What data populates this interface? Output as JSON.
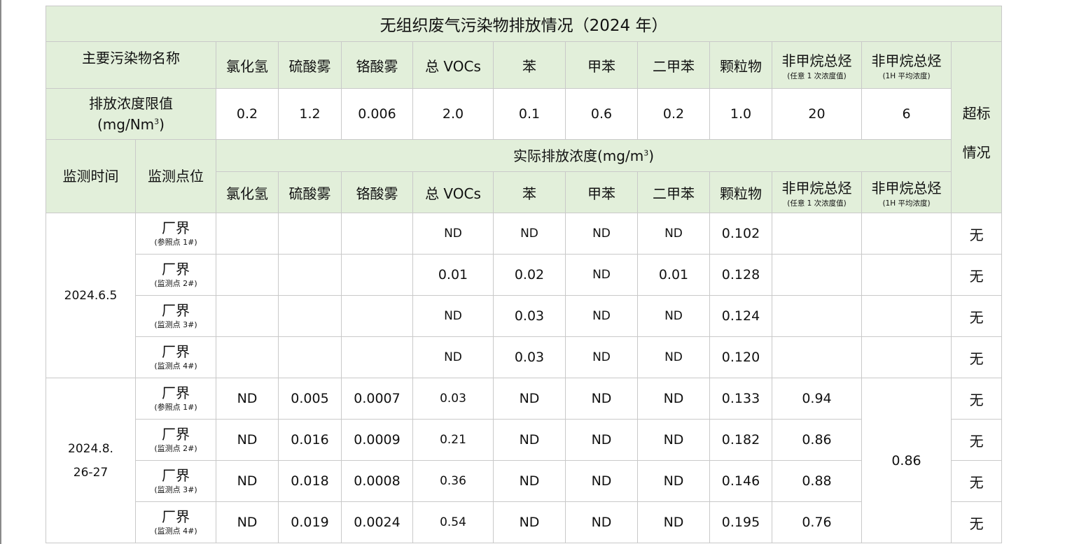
{
  "title": "无组织废气污染物排放情况（2024 年）",
  "header": {
    "pollutant_name_label": "主要污染物名称",
    "limit_label_line1": "排放浓度限值",
    "limit_label_line2": "(mg/Nm",
    "limit_label_sup": "3",
    "limit_label_end": ")",
    "exceed_line1": "超标",
    "exceed_line2": "情况",
    "time_label": "监测时间",
    "point_label": "监测点位",
    "actual_label": "实际排放浓度(mg/m",
    "actual_sup": "3",
    "actual_end": ")",
    "pollutants": [
      {
        "name": "氯化氢",
        "sub": ""
      },
      {
        "name": "硫酸雾",
        "sub": ""
      },
      {
        "name": "铬酸雾",
        "sub": ""
      },
      {
        "name": "总 VOCs",
        "sub": ""
      },
      {
        "name": "苯",
        "sub": ""
      },
      {
        "name": "甲苯",
        "sub": ""
      },
      {
        "name": "二甲苯",
        "sub": ""
      },
      {
        "name": "颗粒物",
        "sub": ""
      },
      {
        "name": "非甲烷总烃",
        "sub": "(任意 1 次浓度值)"
      },
      {
        "name": "非甲烷总烃",
        "sub": "(1H 平均浓度)"
      }
    ],
    "limits": [
      "0.2",
      "1.2",
      "0.006",
      "2.0",
      "0.1",
      "0.6",
      "0.2",
      "1.0",
      "20",
      "6"
    ]
  },
  "groups": [
    {
      "date_line1": "2024.6.5",
      "date_line2": "",
      "rows": [
        {
          "point": "厂界",
          "point_sub": "(参照点 1#)",
          "values": [
            "",
            "",
            "",
            "ND",
            "ND",
            "ND",
            "ND",
            "0.102",
            "",
            ""
          ],
          "exceed": "无"
        },
        {
          "point": "厂界",
          "point_sub": "(监测点 2#)",
          "values": [
            "",
            "",
            "",
            "0.01",
            "0.02",
            "ND",
            "0.01",
            "0.128",
            "",
            ""
          ],
          "exceed": "无"
        },
        {
          "point": "厂界",
          "point_sub": "(监测点 3#)",
          "values": [
            "",
            "",
            "",
            "ND",
            "0.03",
            "ND",
            "ND",
            "0.124",
            "",
            ""
          ],
          "exceed": "无"
        },
        {
          "point": "厂界",
          "point_sub": "(监测点 4#)",
          "values": [
            "",
            "",
            "",
            "ND",
            "0.03",
            "ND",
            "ND",
            "0.120",
            "",
            ""
          ],
          "exceed": "无"
        }
      ]
    },
    {
      "date_line1": "2024.8.",
      "date_line2": "26-27",
      "hourly_avg": "0.86",
      "rows": [
        {
          "point": "厂界",
          "point_sub": "(参照点 1#)",
          "values": [
            "ND",
            "0.005",
            "0.0007",
            "0.03",
            "ND",
            "ND",
            "ND",
            "0.133",
            "0.94"
          ],
          "exceed": "无"
        },
        {
          "point": "厂界",
          "point_sub": "(监测点 2#)",
          "values": [
            "ND",
            "0.016",
            "0.0009",
            "0.21",
            "ND",
            "ND",
            "ND",
            "0.182",
            "0.86"
          ],
          "exceed": "无"
        },
        {
          "point": "厂界",
          "point_sub": "(监测点 3#)",
          "values": [
            "ND",
            "0.018",
            "0.0008",
            "0.36",
            "ND",
            "ND",
            "ND",
            "0.146",
            "0.88"
          ],
          "exceed": "无"
        },
        {
          "point": "厂界",
          "point_sub": "(监测点 4#)",
          "values": [
            "ND",
            "0.019",
            "0.0024",
            "0.54",
            "ND",
            "ND",
            "ND",
            "0.195",
            "0.76"
          ],
          "exceed": "无"
        }
      ]
    }
  ]
}
